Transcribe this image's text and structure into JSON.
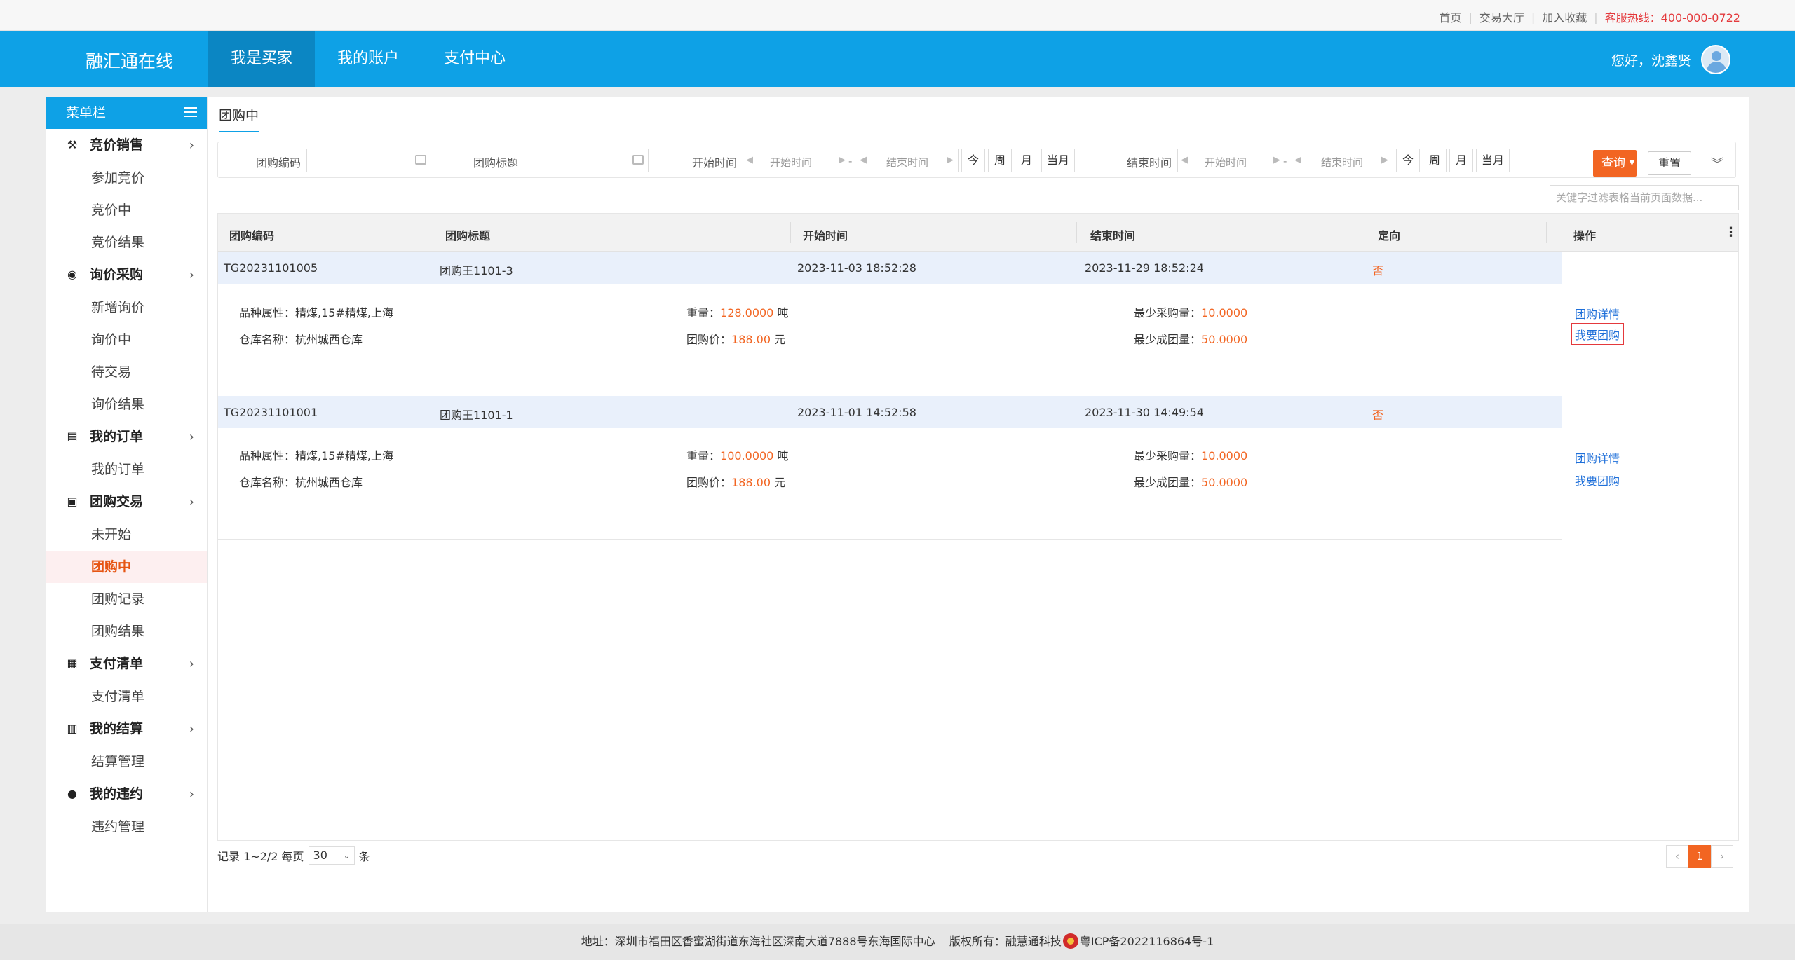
{
  "topbar": {
    "links": [
      "首页",
      "交易大厅",
      "加入收藏"
    ],
    "hotline": "客服热线：400-000-0722"
  },
  "header": {
    "brand": "融汇通在线",
    "nav": [
      {
        "label": "我是买家",
        "active": true
      },
      {
        "label": "我的账户",
        "active": false
      },
      {
        "label": "支付中心",
        "active": false
      }
    ],
    "greeting": "您好，沈鑫贤"
  },
  "sidebar": {
    "title": "菜单栏",
    "groups": [
      {
        "label": "竞价销售",
        "icon": "gavel-icon",
        "items": [
          "参加竞价",
          "竞价中",
          "竞价结果"
        ]
      },
      {
        "label": "询价采购",
        "icon": "search-circle-icon",
        "items": [
          "新增询价",
          "询价中",
          "待交易",
          "询价结果"
        ]
      },
      {
        "label": "我的订单",
        "icon": "document-icon",
        "items": [
          "我的订单"
        ]
      },
      {
        "label": "团购交易",
        "icon": "group-buy-icon",
        "items": [
          "未开始",
          "团购中",
          "团购记录",
          "团购结果"
        ]
      },
      {
        "label": "支付清单",
        "icon": "payment-icon",
        "items": [
          "支付清单"
        ]
      },
      {
        "label": "我的结算",
        "icon": "calculator-icon",
        "items": [
          "结算管理"
        ]
      },
      {
        "label": "我的违约",
        "icon": "alert-icon",
        "items": [
          "违约管理"
        ]
      }
    ],
    "active_item": "团购中"
  },
  "content": {
    "tab": "团购中",
    "filter": {
      "code_label": "团购编码",
      "title_label": "团购标题",
      "start_label": "开始时间",
      "end_label": "结束时间",
      "range_start_ph": "开始时间",
      "range_end_ph": "结束时间",
      "range_sep": "-",
      "quick": [
        "今",
        "周",
        "月",
        "当月"
      ],
      "query": "查询",
      "reset": "重置"
    },
    "search_placeholder": "关键字过滤表格当前页面数据...",
    "columns": [
      "团购编码",
      "团购标题",
      "开始时间",
      "结束时间",
      "定向",
      "操作"
    ],
    "rows": [
      {
        "code": "TG20231101005",
        "title": "团购王1101-3",
        "start": "2023-11-03 18:52:28",
        "end": "2023-11-29 18:52:24",
        "directed": "否",
        "attr_label": "品种属性：",
        "attr": "精煤,15#精煤,上海",
        "warehouse_label": "仓库名称：",
        "warehouse": "杭州城西仓库",
        "weight_label": "重量：",
        "weight": "128.0000",
        "weight_unit": "吨",
        "price_label": "团购价：",
        "price": "188.00",
        "price_unit": "元",
        "min_buy_label": "最少采购量：",
        "min_buy": "10.0000",
        "min_group_label": "最少成团量：",
        "min_group": "50.0000",
        "detail_link": "团购详情",
        "join_link": "我要团购"
      },
      {
        "code": "TG20231101001",
        "title": "团购王1101-1",
        "start": "2023-11-01 14:52:58",
        "end": "2023-11-30 14:49:54",
        "directed": "否",
        "attr_label": "品种属性：",
        "attr": "精煤,15#精煤,上海",
        "warehouse_label": "仓库名称：",
        "warehouse": "杭州城西仓库",
        "weight_label": "重量：",
        "weight": "100.0000",
        "weight_unit": "吨",
        "price_label": "团购价：",
        "price": "188.00",
        "price_unit": "元",
        "min_buy_label": "最少采购量：",
        "min_buy": "10.0000",
        "min_group_label": "最少成团量：",
        "min_group": "50.0000",
        "detail_link": "团购详情",
        "join_link": "我要团购"
      }
    ],
    "pager": {
      "records": "记录 1~2/2 每页",
      "page_size": "30",
      "unit": "条",
      "prev": "‹",
      "current": "1",
      "next": "›"
    }
  },
  "footer": {
    "address": "地址：深圳市福田区香蜜湖街道东海社区深南大道7888号东海国际中心",
    "copyright": "版权所有：融慧通科技",
    "icp": "粤ICP备2022116864号-1"
  },
  "colors": {
    "brand_blue": "#0ea1e6",
    "accent_orange": "#f26522",
    "link_blue": "#1e6fd9",
    "highlight_red": "#e4393c"
  }
}
